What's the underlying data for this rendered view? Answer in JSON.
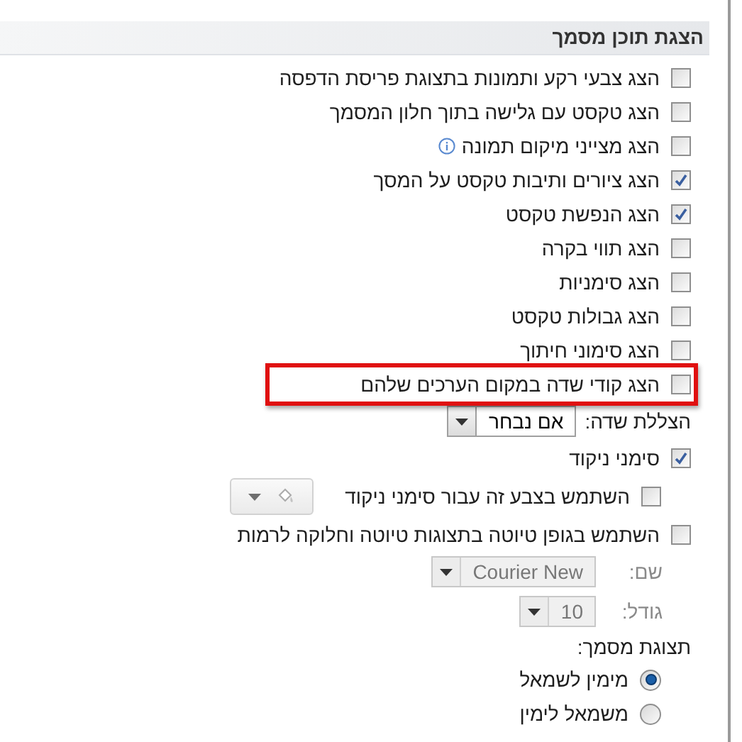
{
  "section": {
    "title": "הצגת תוכן מסמך"
  },
  "options": [
    {
      "kind": "checkbox",
      "label": "הצג צבעי רקע ותמונות בתצוגת פריסת הדפסה",
      "checked": false
    },
    {
      "kind": "checkbox",
      "label": "הצג טקסט עם גלישה בתוך חלון המסמך",
      "checked": false
    },
    {
      "kind": "checkbox",
      "label": "הצג מצייני מיקום תמונה",
      "checked": false,
      "has_info": true
    },
    {
      "kind": "checkbox",
      "label": "הצג ציורים ותיבות טקסט על המסך",
      "checked": true
    },
    {
      "kind": "checkbox",
      "label": "הצג הנפשת טקסט",
      "checked": true
    },
    {
      "kind": "checkbox",
      "label": "הצג תווי בקרה",
      "checked": false
    },
    {
      "kind": "checkbox",
      "label": "הצג סימניות",
      "checked": false
    },
    {
      "kind": "checkbox",
      "label": "הצג גבולות טקסט",
      "checked": false
    },
    {
      "kind": "checkbox",
      "label": "הצג סימוני חיתוך",
      "checked": false
    },
    {
      "kind": "checkbox",
      "label": "הצג קודי שדה במקום הערכים שלהם",
      "checked": false,
      "highlighted": true
    },
    {
      "kind": "select",
      "label": "הצללת שדה:",
      "value": "אם נבחר",
      "disabled": false
    },
    {
      "kind": "checkbox",
      "label": "סימני ניקוד",
      "checked": true,
      "children": [
        {
          "kind": "color",
          "label": "השתמש בצבע זה עבור סימני ניקוד",
          "checked": false,
          "disabled": true
        }
      ]
    },
    {
      "kind": "checkbox",
      "label": "השתמש בגופן טיוטה בתצוגות טיוטה וחלוקה לרמות",
      "checked": false,
      "children": [
        {
          "kind": "select",
          "label": "שם:",
          "value": "Courier New",
          "disabled": true
        },
        {
          "kind": "select",
          "label": "גודל:",
          "value": "10",
          "disabled": true
        }
      ]
    },
    {
      "kind": "label",
      "label": "תצוגת מסמך:",
      "children": [
        {
          "kind": "radio",
          "label": "מימין לשמאל",
          "selected": true
        },
        {
          "kind": "radio",
          "label": "משמאל לימין",
          "selected": false
        }
      ]
    }
  ]
}
